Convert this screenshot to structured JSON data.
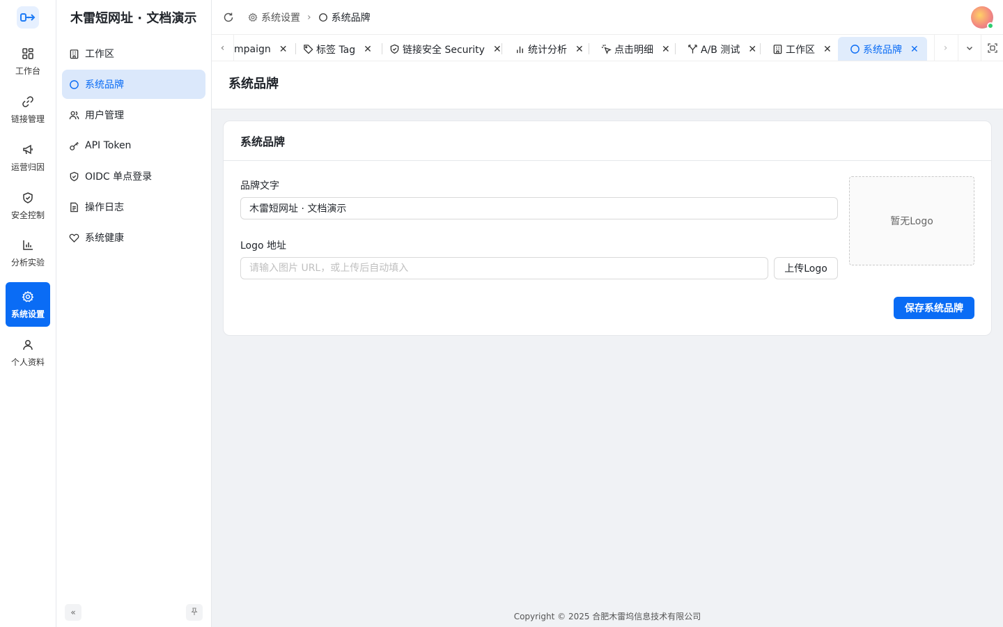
{
  "app": {
    "title": "木雷短网址 · 文档演示"
  },
  "rail": {
    "items": [
      {
        "label": "工作台",
        "icon": "dashboard-icon"
      },
      {
        "label": "链接管理",
        "icon": "link-icon"
      },
      {
        "label": "运营归因",
        "icon": "megaphone-icon"
      },
      {
        "label": "安全控制",
        "icon": "shield-icon"
      },
      {
        "label": "分析实验",
        "icon": "bar-chart-icon"
      },
      {
        "label": "系统设置",
        "icon": "gear-icon",
        "active": true
      },
      {
        "label": "个人资料",
        "icon": "user-icon"
      }
    ]
  },
  "sidebar": {
    "items": [
      {
        "label": "工作区",
        "icon": "building-icon"
      },
      {
        "label": "系统品牌",
        "icon": "circle-icon",
        "active": true
      },
      {
        "label": "用户管理",
        "icon": "users-icon"
      },
      {
        "label": "API Token",
        "icon": "key-icon"
      },
      {
        "label": "OIDC 单点登录",
        "icon": "shield-check-icon"
      },
      {
        "label": "操作日志",
        "icon": "document-icon"
      },
      {
        "label": "系统健康",
        "icon": "heart-icon"
      }
    ]
  },
  "breadcrumb": {
    "parent": "系统设置",
    "current": "系统品牌"
  },
  "tabs": [
    {
      "label": "mpaign",
      "icon": ""
    },
    {
      "label": "标签 Tag",
      "icon": "tag-icon"
    },
    {
      "label": "链接安全 Security",
      "icon": "shield-icon"
    },
    {
      "label": "统计分析",
      "icon": "bar-chart-icon"
    },
    {
      "label": "点击明细",
      "icon": "click-icon"
    },
    {
      "label": "A/B 测试",
      "icon": "split-icon"
    },
    {
      "label": "工作区",
      "icon": "building-icon"
    },
    {
      "label": "系统品牌",
      "icon": "circle-icon",
      "active": true
    }
  ],
  "page": {
    "title": "系统品牌"
  },
  "form": {
    "card_title": "系统品牌",
    "brand_label": "品牌文字",
    "brand_value": "木雷短网址 · 文档演示",
    "logo_label": "Logo 地址",
    "logo_value": "",
    "logo_placeholder": "请输入图片 URL，或上传后自动填入",
    "upload_label": "上传Logo",
    "preview_text": "暂无Logo",
    "save_label": "保存系统品牌"
  },
  "footer": {
    "copyright": "Copyright © 2025 合肥木雷坞信息技术有限公司"
  },
  "colors": {
    "accent": "#0a6cf5",
    "active_bg": "#dbe8fb",
    "page_bg": "#f0f2f5"
  }
}
